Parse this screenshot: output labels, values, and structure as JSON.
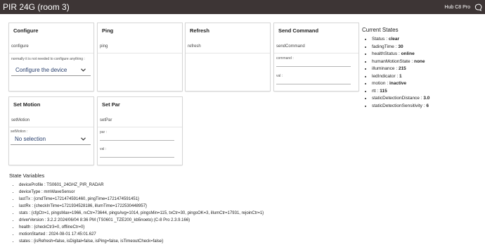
{
  "header": {
    "title": "PIR 24G (room 3)",
    "hub": "Hub C8 Pro",
    "chat_icon": "chat-icon"
  },
  "commands": {
    "configure": {
      "name": "Configure",
      "command": "configure",
      "note": "normally it is not needed to configure anything :",
      "select_value": "Configure the device"
    },
    "ping": {
      "name": "Ping",
      "command": "ping"
    },
    "refresh": {
      "name": "Refresh",
      "command": "refresh"
    },
    "send_command": {
      "name": "Send Command",
      "command": "sendCommand",
      "field1": "command :",
      "field2": "val :"
    },
    "set_motion": {
      "name": "Set Motion",
      "command": "setMotion",
      "select_label": "setMotion :",
      "select_value": "No selection"
    },
    "set_par": {
      "name": "Set Par",
      "command": "setPar",
      "field1": "par :",
      "field2": "val :"
    }
  },
  "current_states": {
    "header": "Current States",
    "items": [
      {
        "key": "Status",
        "value": "clear"
      },
      {
        "key": "fadingTime",
        "value": "30"
      },
      {
        "key": "healthStatus",
        "value": "online"
      },
      {
        "key": "humanMotionState",
        "value": "none"
      },
      {
        "key": "illuminance",
        "value": "215"
      },
      {
        "key": "ledIndicator",
        "value": "1"
      },
      {
        "key": "motion",
        "value": "inactive"
      },
      {
        "key": "rtt",
        "value": "115"
      },
      {
        "key": "staticDetectionDistance",
        "value": "3.0"
      },
      {
        "key": "staticDetectionSensitivity",
        "value": "6"
      }
    ]
  },
  "state_variables": {
    "header": "State Variables",
    "items": [
      {
        "key": "deviceProfile",
        "value": "TS0601_24GHZ_PIR_RADAR"
      },
      {
        "key": "deviceType",
        "value": "mmWaveSensor"
      },
      {
        "key": "lastTx",
        "value": "{cmdTime=1721474591460, pingTime=1721474591451}"
      },
      {
        "key": "lastRx",
        "value": "{checkInTime=1721934528186, illumTime=1722530448957}"
      },
      {
        "key": "stats",
        "value": "{cfgCtr=1, pingsMax=1966, rxCtr=73644, pingsAvg=1014, pingsMin=115, txCtr=30, pingsOK=3, illumCtr=17931, rejoinCtr=1}"
      },
      {
        "key": "driverVersion",
        "value": "3.2.2 2024/06/04 8:36 PM (TS0601 _TZE200_kb5noeto) (C-8 Pro 2.3.9.166)"
      },
      {
        "key": "health",
        "value": "{checkCtr3=0, offlineCtr=0}"
      },
      {
        "key": "motionStarted",
        "value": "2024-08-01 17:45:01.627"
      },
      {
        "key": "states",
        "value": "{isRefresh=false, isDigital=false, isPing=false, isTimeoutCheck=false}"
      }
    ]
  },
  "colors": {
    "topbar": "#3d3535",
    "select_text": "#263d6b"
  }
}
